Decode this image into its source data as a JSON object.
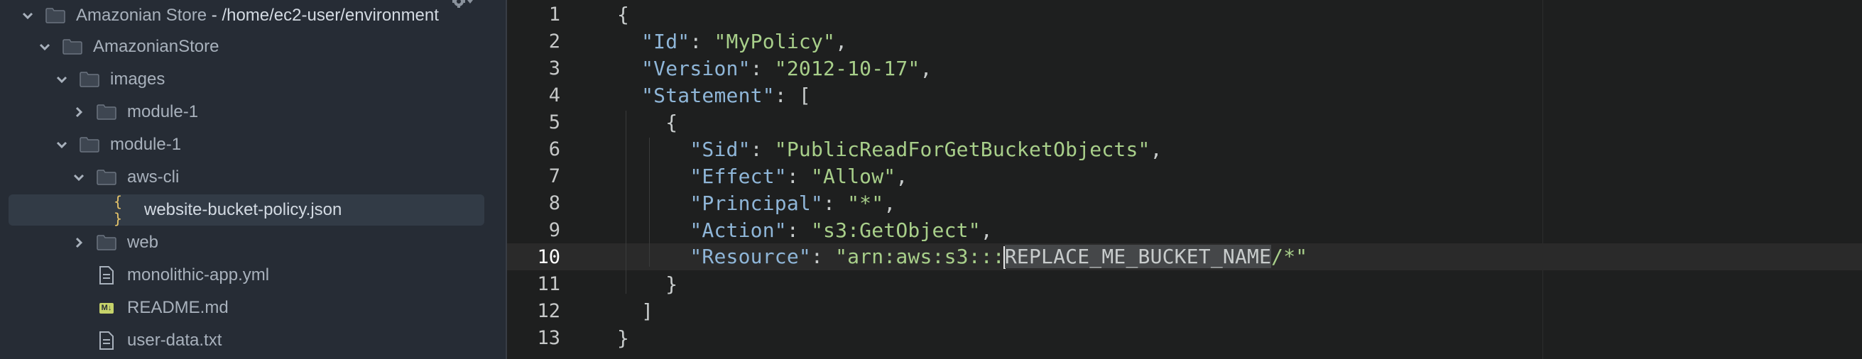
{
  "sidebar": {
    "items": [
      {
        "label": "Amazonian Store",
        "suffix": " - /home/ec2-user/environment",
        "type": "folder",
        "expanded": true
      },
      {
        "label": "AmazonianStore",
        "type": "folder",
        "expanded": true
      },
      {
        "label": "images",
        "type": "folder",
        "expanded": true
      },
      {
        "label": "module-1",
        "type": "folder",
        "expanded": false
      },
      {
        "label": "module-1",
        "type": "folder",
        "expanded": true
      },
      {
        "label": "aws-cli",
        "type": "folder",
        "expanded": true
      },
      {
        "label": "website-bucket-policy.json",
        "type": "json-file",
        "icon_text": "{ }",
        "selected": true
      },
      {
        "label": "web",
        "type": "folder",
        "expanded": false
      },
      {
        "label": "monolithic-app.yml",
        "type": "file"
      },
      {
        "label": "README.md",
        "type": "markdown-file",
        "icon_text": "M↓"
      },
      {
        "label": "user-data.txt",
        "type": "file"
      }
    ]
  },
  "editor": {
    "active_line": 10,
    "lines": [
      {
        "number": "1",
        "tokens": [
          {
            "t": "{",
            "c": "punc"
          }
        ]
      },
      {
        "number": "2",
        "tokens": [
          {
            "t": "  ",
            "c": "punc"
          },
          {
            "t": "\"Id\"",
            "c": "key"
          },
          {
            "t": ": ",
            "c": "punc"
          },
          {
            "t": "\"MyPolicy\"",
            "c": "str"
          },
          {
            "t": ",",
            "c": "punc"
          }
        ]
      },
      {
        "number": "3",
        "tokens": [
          {
            "t": "  ",
            "c": "punc"
          },
          {
            "t": "\"Version\"",
            "c": "key"
          },
          {
            "t": ": ",
            "c": "punc"
          },
          {
            "t": "\"2012-10-17\"",
            "c": "str"
          },
          {
            "t": ",",
            "c": "punc"
          }
        ]
      },
      {
        "number": "4",
        "tokens": [
          {
            "t": "  ",
            "c": "punc"
          },
          {
            "t": "\"Statement\"",
            "c": "key"
          },
          {
            "t": ": [",
            "c": "punc"
          }
        ]
      },
      {
        "number": "5",
        "tokens": [
          {
            "t": "    {",
            "c": "punc"
          }
        ]
      },
      {
        "number": "6",
        "tokens": [
          {
            "t": "      ",
            "c": "punc"
          },
          {
            "t": "\"Sid\"",
            "c": "key"
          },
          {
            "t": ": ",
            "c": "punc"
          },
          {
            "t": "\"PublicReadForGetBucketObjects\"",
            "c": "str"
          },
          {
            "t": ",",
            "c": "punc"
          }
        ]
      },
      {
        "number": "7",
        "tokens": [
          {
            "t": "      ",
            "c": "punc"
          },
          {
            "t": "\"Effect\"",
            "c": "key"
          },
          {
            "t": ": ",
            "c": "punc"
          },
          {
            "t": "\"Allow\"",
            "c": "str"
          },
          {
            "t": ",",
            "c": "punc"
          }
        ]
      },
      {
        "number": "8",
        "tokens": [
          {
            "t": "      ",
            "c": "punc"
          },
          {
            "t": "\"Principal\"",
            "c": "key"
          },
          {
            "t": ": ",
            "c": "punc"
          },
          {
            "t": "\"*\"",
            "c": "str"
          },
          {
            "t": ",",
            "c": "punc"
          }
        ]
      },
      {
        "number": "9",
        "tokens": [
          {
            "t": "      ",
            "c": "punc"
          },
          {
            "t": "\"Action\"",
            "c": "key"
          },
          {
            "t": ": ",
            "c": "punc"
          },
          {
            "t": "\"s3:GetObject\"",
            "c": "str"
          },
          {
            "t": ",",
            "c": "punc"
          }
        ]
      },
      {
        "number": "10",
        "tokens": [
          {
            "t": "      ",
            "c": "punc"
          },
          {
            "t": "\"Resource\"",
            "c": "key"
          },
          {
            "t": ": ",
            "c": "punc"
          },
          {
            "t": "\"arn:aws:s3:::",
            "c": "str"
          },
          {
            "t": "",
            "c": "cursor"
          },
          {
            "t": "REPLACE_ME_BUCKET_NAME",
            "c": "sel"
          },
          {
            "t": "/*\"",
            "c": "str"
          }
        ]
      },
      {
        "number": "11",
        "tokens": [
          {
            "t": "    }",
            "c": "punc"
          }
        ]
      },
      {
        "number": "12",
        "tokens": [
          {
            "t": "  ]",
            "c": "punc"
          }
        ]
      },
      {
        "number": "13",
        "tokens": [
          {
            "t": "}",
            "c": "punc"
          }
        ]
      }
    ]
  },
  "colors": {
    "sidebar_bg": "#262c35",
    "editor_bg": "#1e1f1f",
    "json_key": "#8fb6d8",
    "json_string": "#a8cf8a",
    "json_icon": "#e6c46a",
    "markdown_icon": "#c6d36a"
  }
}
